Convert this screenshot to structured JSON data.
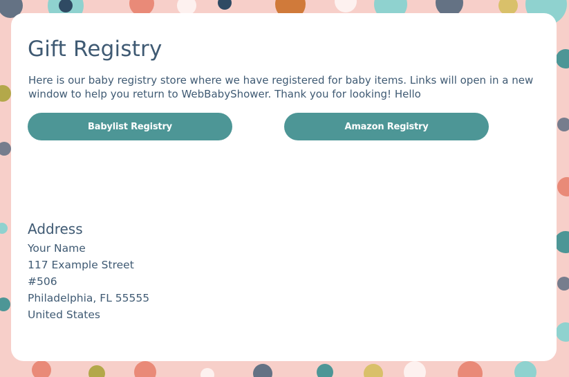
{
  "page": {
    "title": "Gift Registry",
    "intro": "Here is our baby registry store where we have registered for baby items. Links will open in a new window to help you return to WebBabyShower. Thank you for looking! Hello"
  },
  "registries": [
    {
      "label": "Babylist Registry"
    },
    {
      "label": "Amazon Registry"
    }
  ],
  "address": {
    "heading": "Address",
    "name": "Your Name",
    "street": "117 Example Street",
    "unit": "#506",
    "city_state_zip": "Philadelphia, FL 55555",
    "country": "United States"
  },
  "colors": {
    "background_pink": "#f7cfc9",
    "button_teal": "#4d9696",
    "text_slate": "#3f5a73",
    "card": "#ffffff"
  }
}
